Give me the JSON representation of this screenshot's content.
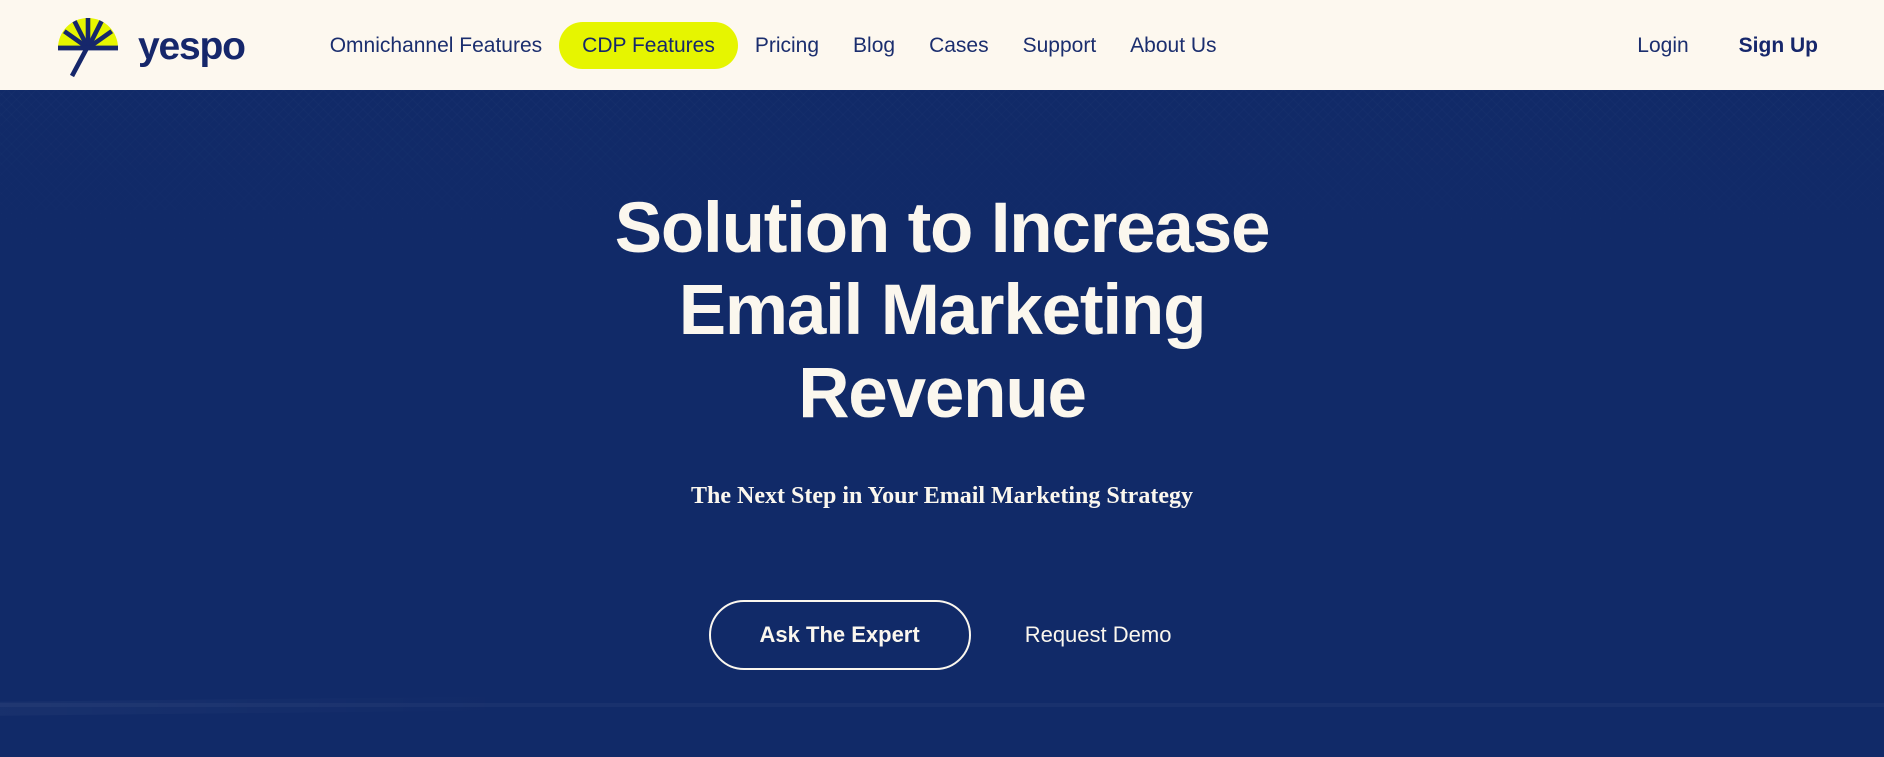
{
  "colors": {
    "header_bg": "#FDF8EF",
    "hero_bg": "#112A68",
    "brand_navy": "#16276B",
    "accent_yellow": "#E6F500",
    "cream_text": "#FBF7EE"
  },
  "header": {
    "logo": {
      "mark_name": "yespo-fan-logo-icon",
      "wordmark": "yespo"
    },
    "nav": [
      {
        "label": "Omnichannel Features",
        "active": false
      },
      {
        "label": "CDP Features",
        "active": true
      },
      {
        "label": "Pricing",
        "active": false
      },
      {
        "label": "Blog",
        "active": false
      },
      {
        "label": "Cases",
        "active": false
      },
      {
        "label": "Support",
        "active": false
      },
      {
        "label": "About Us",
        "active": false
      }
    ],
    "auth": {
      "login_label": "Login",
      "signup_label": "Sign Up"
    }
  },
  "hero": {
    "title": "Solution to Increase Email Marketing Revenue",
    "subtitle": "The Next Step in Your Email Marketing Strategy",
    "primary_cta": "Ask The Expert",
    "secondary_cta": "Request Demo"
  }
}
